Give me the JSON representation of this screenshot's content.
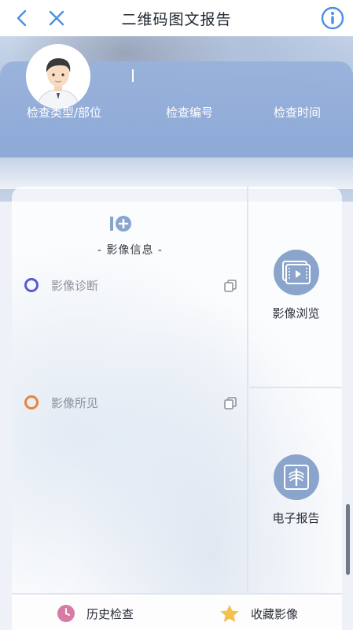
{
  "navbar": {
    "title": "二维码图文报告",
    "back_icon": "chevron-left-icon",
    "close_icon": "close-icon",
    "info_icon": "info-icon"
  },
  "header": {
    "labels": [
      "检查类型/部位",
      "检查编号",
      "检查时间"
    ]
  },
  "image_info": {
    "title": "- 影像信息 -",
    "diagnosis_label": "影像诊断",
    "findings_label": "影像所见"
  },
  "tiles": {
    "browse_label": "影像浏览",
    "report_label": "电子报告"
  },
  "bottom": {
    "history_label": "历史检查",
    "favorites_label": "收藏影像"
  },
  "colors": {
    "accent": "#4a8ee8",
    "header_blue": "#98b2dc",
    "icon_circle": "#8aa4cc",
    "diagnosis_circle": "#5a5ad6",
    "findings_circle": "#e8853d",
    "history_icon": "#d87aa6",
    "favorites_icon": "#f2c14e"
  }
}
